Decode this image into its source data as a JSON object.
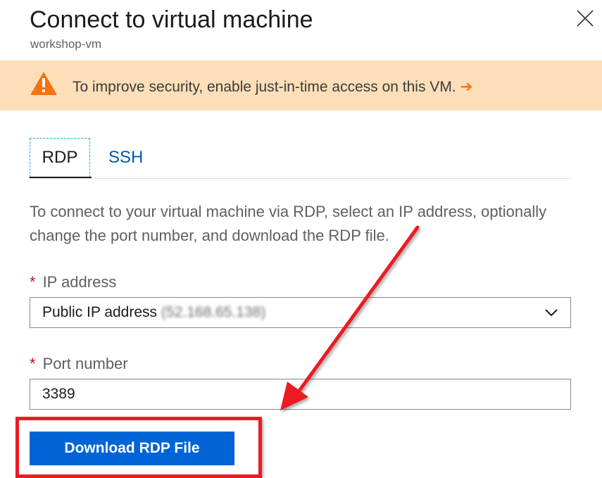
{
  "header": {
    "title": "Connect to virtual machine",
    "subtitle": "workshop-vm",
    "close_icon": "close-icon"
  },
  "banner": {
    "text": "To improve security, enable just-in-time access on this VM.",
    "arrow": "➔",
    "icon": "warning-icon",
    "background_color": "#fcdfb9",
    "icon_color": "#f7730e"
  },
  "tabs": [
    {
      "label": "RDP",
      "selected": true
    },
    {
      "label": "SSH",
      "selected": false
    }
  ],
  "description": "To connect to your virtual machine via RDP, select an IP address, optionally change the port number, and download the RDP file.",
  "ip_field": {
    "required_mark": "*",
    "label": "IP address",
    "selected_value": "Public IP address",
    "blurred_address": "(52.168.65.138)",
    "icon": "chevron-down-icon"
  },
  "port_field": {
    "required_mark": "*",
    "label": "Port number",
    "value": "3389"
  },
  "actions": {
    "download_label": "Download RDP File",
    "button_color": "#0064d6"
  },
  "annotation": {
    "color": "#ea1c24"
  }
}
